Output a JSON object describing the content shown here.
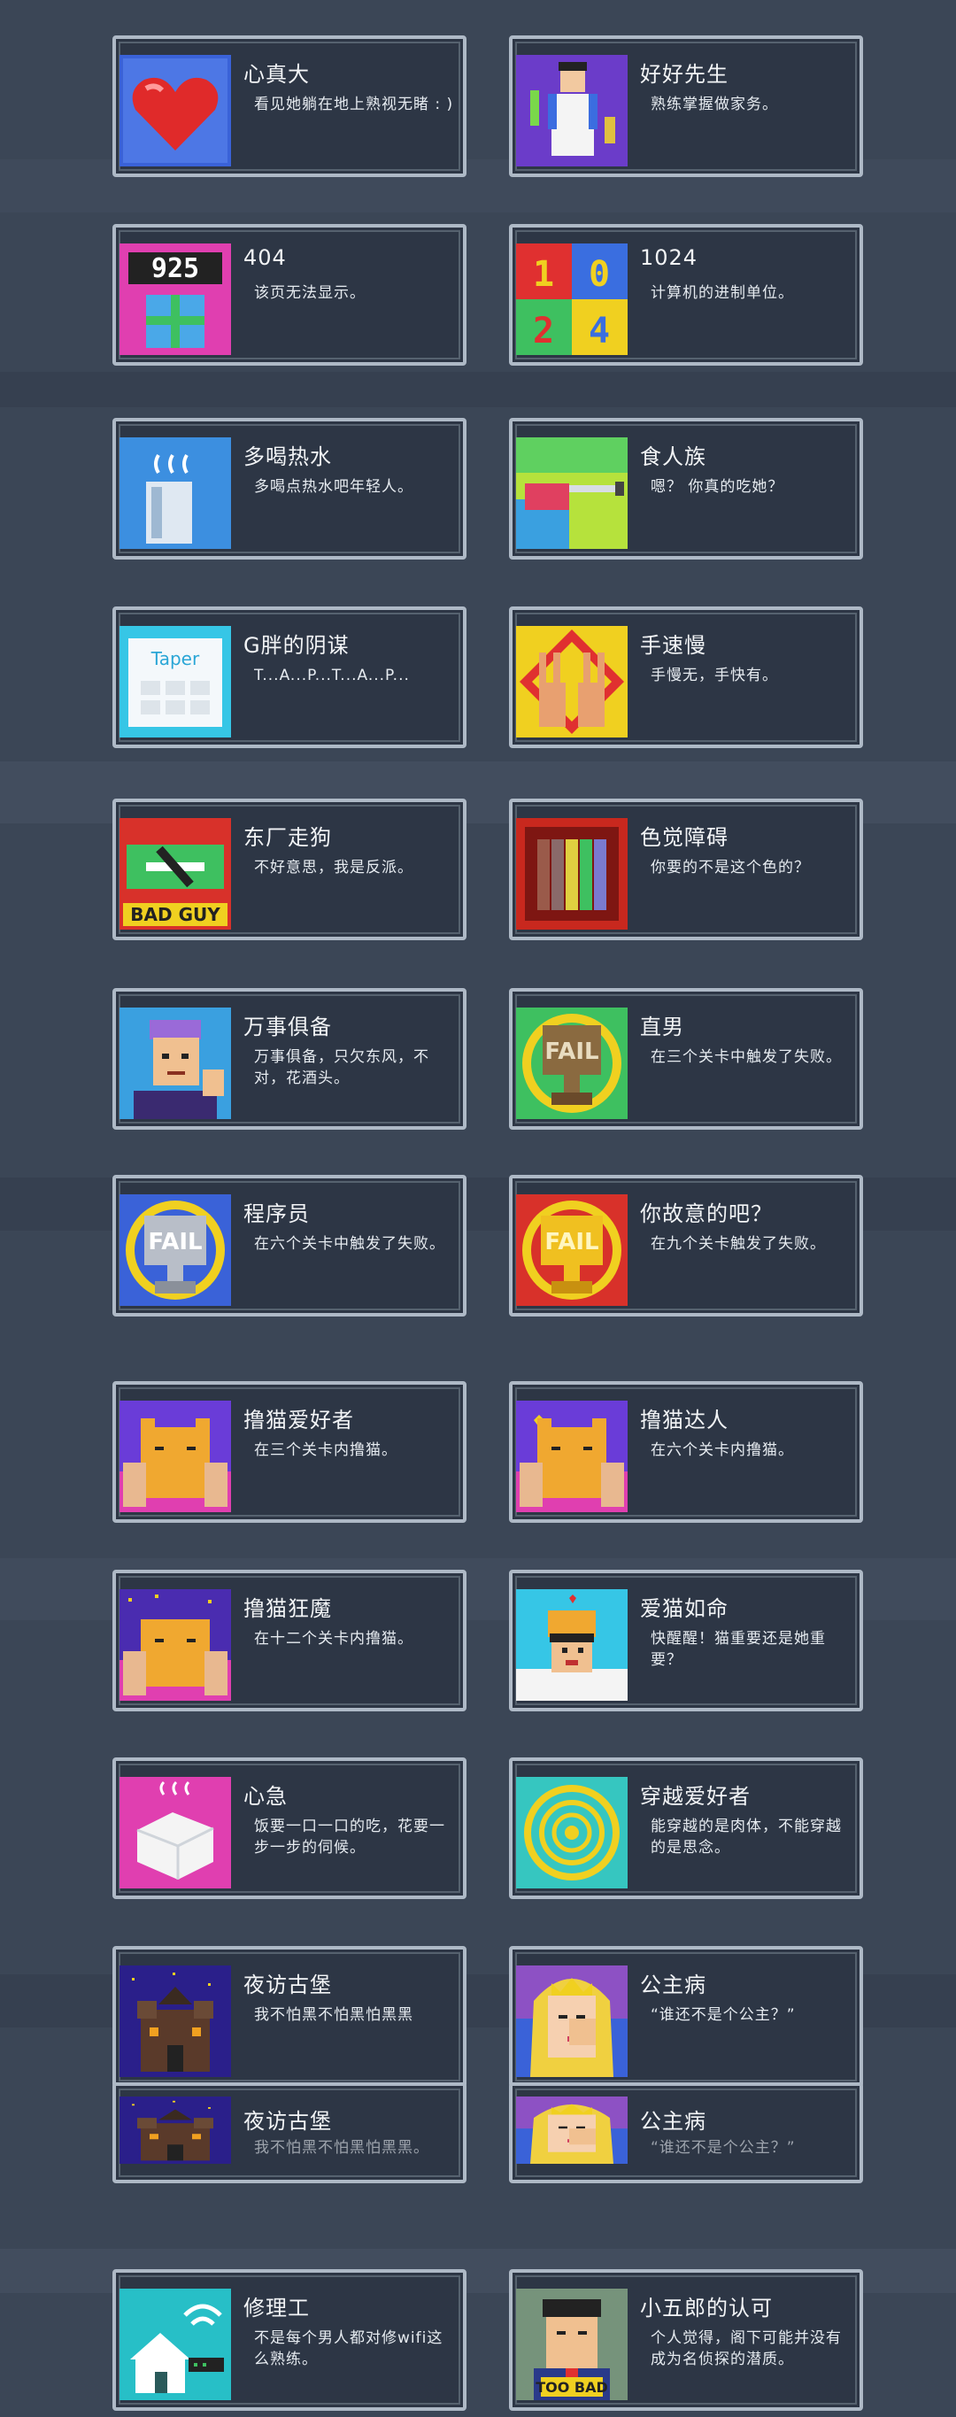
{
  "achievements": [
    {
      "title": "心真大",
      "desc": "看见她躺在地上熟视无睹 : )",
      "icon": "heart-icon"
    },
    {
      "title": "好好先生",
      "desc": "熟练掌握做家务。",
      "icon": "housekeeper-icon"
    },
    {
      "title": "404",
      "desc": "该页无法显示。",
      "icon": "gift-925-icon"
    },
    {
      "title": "1024",
      "desc": "计算机的进制单位。",
      "icon": "number-blocks-icon"
    },
    {
      "title": "多喝热水",
      "desc": "多喝点热水吧年轻人。",
      "icon": "hot-water-cup-icon"
    },
    {
      "title": "食人族",
      "desc": "嗯？ 你真的吃她？",
      "icon": "knife-food-icon"
    },
    {
      "title": "G胖的阴谋",
      "desc": "T...A...P...T...A...P...",
      "icon": "taper-card-icon"
    },
    {
      "title": "手速慢",
      "desc": "手慢无，手快有。",
      "icon": "peace-hands-icon"
    },
    {
      "title": "东厂走狗",
      "desc": "不好意思，我是反派。",
      "icon": "bad-guy-icon"
    },
    {
      "title": "色觉障碍",
      "desc": "你要的不是这个色的？",
      "icon": "color-bars-icon"
    },
    {
      "title": "万事俱备",
      "desc": "万事俱备，只欠东风，不对，花酒头。",
      "icon": "old-man-icon"
    },
    {
      "title": "直男",
      "desc": "在三个关卡中触发了失败。",
      "icon": "bronze-fail-trophy-icon"
    },
    {
      "title": "程序员",
      "desc": "在六个关卡中触发了失败。",
      "icon": "silver-fail-trophy-icon"
    },
    {
      "title": "你故意的吧？",
      "desc": "在九个关卡触发了失败。",
      "icon": "gold-fail-trophy-icon"
    },
    {
      "title": "撸猫爱好者",
      "desc": "在三个关卡内撸猫。",
      "icon": "cat-petting-icon"
    },
    {
      "title": "撸猫达人",
      "desc": "在六个关卡内撸猫。",
      "icon": "cat-heart-icon"
    },
    {
      "title": "撸猫狂魔",
      "desc": "在十二个关卡内撸猫。",
      "icon": "cat-stars-icon"
    },
    {
      "title": "爱猫如命",
      "desc": "快醒醒！猫重要还是她重要？",
      "icon": "cat-on-head-icon"
    },
    {
      "title": "心急",
      "desc": "饭要一口一口的吃，花要一步一步的伺候。",
      "icon": "tofu-icon"
    },
    {
      "title": "穿越爱好者",
      "desc": "能穿越的是肉体，不能穿越的是思念。",
      "icon": "portal-icon"
    },
    {
      "title": "夜访古堡",
      "desc": "我不怕黑不怕黑怕黑黑",
      "icon": "castle-icon"
    },
    {
      "title": "公主病",
      "desc": "“谁还不是个公主？”",
      "icon": "princess-icon"
    },
    {
      "title": "夜访古堡",
      "desc": "我不怕黑不怕黑怕黑黑。",
      "icon": "castle-icon"
    },
    {
      "title": "公主病",
      "desc": "“谁还不是个公主？”",
      "icon": "princess-icon"
    },
    {
      "title": "修理工",
      "desc": "不是每个男人都对修wifi这么熟练。",
      "icon": "wifi-house-icon"
    },
    {
      "title": "小五郎的认可",
      "desc": "个人觉得，阁下可能并没有成为名侦探的潜质。",
      "icon": "too-bad-icon"
    }
  ],
  "colors": {
    "background": "#3b4656",
    "card": "#2d3645",
    "border": "#aeb9c6"
  }
}
